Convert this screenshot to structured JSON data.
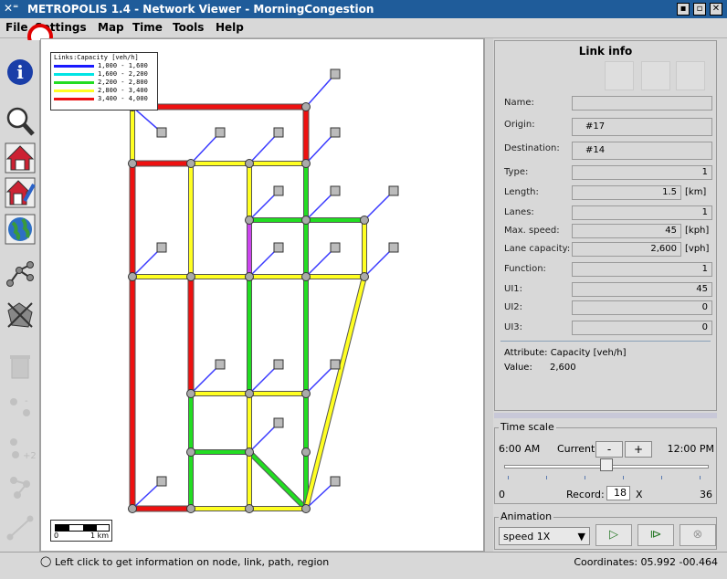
{
  "window": {
    "title": "METROPOLIS 1.4 - Network Viewer - MorningCongestion",
    "controls": [
      "▪",
      "▫",
      "✕"
    ]
  },
  "menu": [
    "File",
    "Settings",
    "Map",
    "Time",
    "Tools",
    "Help"
  ],
  "toolbar": [
    {
      "name": "info-icon",
      "disabled": false
    },
    {
      "name": "zoom-icon",
      "disabled": false
    },
    {
      "name": "home-icon",
      "disabled": false
    },
    {
      "name": "home-edit-icon",
      "disabled": false
    },
    {
      "name": "globe-icon",
      "disabled": false
    },
    {
      "name": "network-nodes-icon",
      "disabled": false
    },
    {
      "name": "region-select-icon",
      "disabled": false
    },
    {
      "name": "trash-icon",
      "disabled": true
    },
    {
      "name": "node-remove-icon",
      "disabled": true
    },
    {
      "name": "node-add-icon",
      "disabled": true
    },
    {
      "name": "node-merge-icon",
      "disabled": true
    },
    {
      "name": "link-tool-icon",
      "disabled": true
    }
  ],
  "map_legend": {
    "title": "Links:Capacity [veh/h]",
    "items": [
      {
        "label": "1,000 - 1,600",
        "color": "#1a1aff"
      },
      {
        "label": "1,600 - 2,200",
        "color": "#00e5e5"
      },
      {
        "label": "2,200 - 2,800",
        "color": "#22dd22"
      },
      {
        "label": "2,800 - 3,400",
        "color": "#ffff22"
      },
      {
        "label": "3,400 - 4,000",
        "color": "#ee1111"
      }
    ]
  },
  "scale_bar": {
    "left": "0",
    "right": "1 km"
  },
  "link_info": {
    "title": "Link info",
    "fields": [
      {
        "label": "Name:",
        "value": "",
        "unit": ""
      },
      {
        "label": "Origin:",
        "value": "#17",
        "unit": ""
      },
      {
        "label": "Destination:",
        "value": "#14",
        "unit": ""
      },
      {
        "label": "Type:",
        "value": "1",
        "unit": ""
      },
      {
        "label": "Length:",
        "value": "1.5",
        "unit": "[km]"
      },
      {
        "label": "Lanes:",
        "value": "1",
        "unit": ""
      },
      {
        "label": "Max. speed:",
        "value": "45",
        "unit": "[kph]"
      },
      {
        "label": "Lane capacity:",
        "value": "2,600",
        "unit": "[vph]"
      },
      {
        "label": "Function:",
        "value": "1",
        "unit": ""
      },
      {
        "label": "UI1:",
        "value": "45",
        "unit": ""
      },
      {
        "label": "UI2:",
        "value": "0",
        "unit": ""
      },
      {
        "label": "UI3:",
        "value": "0",
        "unit": ""
      }
    ],
    "attribute_line": "Attribute: Capacity [veh/h]",
    "value_label": "Value:",
    "value": "2,600"
  },
  "time_scale": {
    "legend": "Time scale",
    "start": "6:00 AM",
    "current_label": "Current:",
    "minus": "-",
    "plus": "+",
    "end": "12:00 PM",
    "slider_position": 0.5,
    "min": "0",
    "record_label": "Record:",
    "record_value": "18",
    "record_unit": "X",
    "max": "36"
  },
  "animation": {
    "legend": "Animation",
    "speed": "speed 1X",
    "play": "▷",
    "fast_forward": "⧐",
    "stop": "⊗"
  },
  "status": {
    "hint": "Left click to get information on node, link, path, region",
    "coordinates": "Coordinates: 05.992 -00.464"
  }
}
